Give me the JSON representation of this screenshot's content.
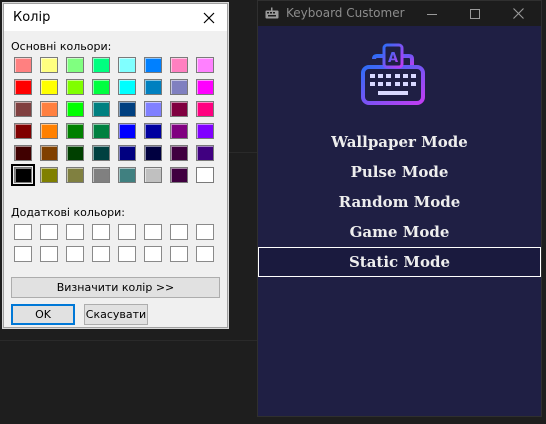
{
  "keyboard_customer": {
    "title": "Keyboard Customer",
    "modes": [
      "Wallpaper Mode",
      "Pulse Mode",
      "Random Mode",
      "Game Mode",
      "Static Mode"
    ],
    "selected_mode": "Static Mode",
    "logo_gradient": [
      "#2f6cf6",
      "#c13cf2"
    ]
  },
  "color_dialog": {
    "title": "Колір",
    "basic_colors_label": "Основні кольори:",
    "custom_colors_label": "Додаткові кольори:",
    "define_button": "Визначити колір >>",
    "ok_button": "OK",
    "cancel_button": "Скасувати",
    "basic_colors": [
      [
        "#ff8080",
        "#ffff80",
        "#80ff80",
        "#00ff80",
        "#80ffff",
        "#0080ff",
        "#ff80c0",
        "#ff80ff"
      ],
      [
        "#ff0000",
        "#ffff00",
        "#80ff00",
        "#00ff40",
        "#00ffff",
        "#0080c0",
        "#8080c0",
        "#ff00ff"
      ],
      [
        "#804040",
        "#ff8040",
        "#00ff00",
        "#008080",
        "#004080",
        "#8080ff",
        "#800040",
        "#ff0080"
      ],
      [
        "#800000",
        "#ff8000",
        "#008000",
        "#008040",
        "#0000ff",
        "#0000a0",
        "#800080",
        "#8000ff"
      ],
      [
        "#400000",
        "#804000",
        "#004000",
        "#004040",
        "#000080",
        "#000040",
        "#400040",
        "#400080"
      ],
      [
        "#000000",
        "#808000",
        "#808040",
        "#808080",
        "#408080",
        "#c0c0c0",
        "#400040",
        "#ffffff"
      ]
    ],
    "selected_color": "#000000"
  }
}
